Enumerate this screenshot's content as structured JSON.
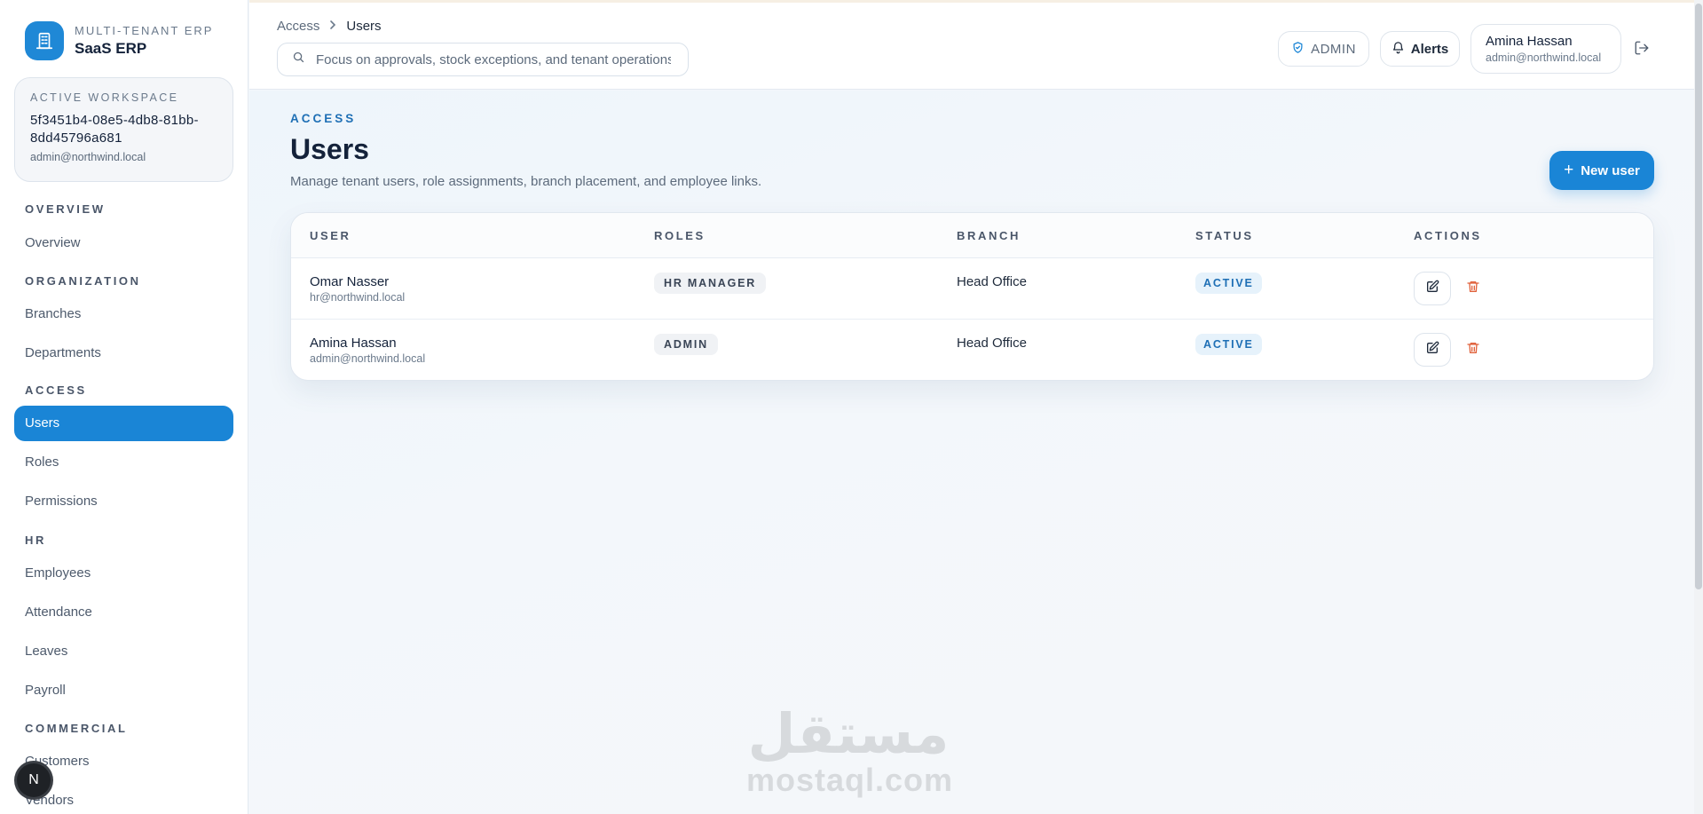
{
  "brand": {
    "subtitle": "MULTI-TENANT ERP",
    "name": "SaaS ERP",
    "icon": "building-icon"
  },
  "workspace": {
    "label": "ACTIVE WORKSPACE",
    "id": "5f3451b4-08e5-4db8-81bb-8dd45796a681",
    "email": "admin@northwind.local"
  },
  "nav": {
    "sections": [
      "OVERVIEW",
      "ORGANIZATION",
      "ACCESS",
      "HR",
      "COMMERCIAL"
    ],
    "items": [
      "Overview",
      "Branches",
      "Departments",
      "Users",
      "Roles",
      "Permissions",
      "Employees",
      "Attendance",
      "Leaves",
      "Payroll",
      "Customers",
      "Vendors"
    ],
    "active": "Users"
  },
  "devtools_badge": "N",
  "topbar": {
    "breadcrumb": [
      "Access",
      "Users"
    ],
    "search_placeholder": "Focus on approvals, stock exceptions, and tenant operations",
    "role_pill": "ADMIN",
    "alerts_label": "Alerts",
    "user": {
      "name": "Amina Hassan",
      "email": "admin@northwind.local"
    }
  },
  "page": {
    "eyebrow": "ACCESS",
    "title": "Users",
    "description": "Manage tenant users, role assignments, branch placement, and employee links.",
    "new_button": "New user"
  },
  "table": {
    "columns": [
      "USER",
      "ROLES",
      "BRANCH",
      "STATUS",
      "ACTIONS"
    ],
    "rows": [
      {
        "name": "Omar Nasser",
        "email": "hr@northwind.local",
        "role": "HR MANAGER",
        "branch": "Head Office",
        "status": "ACTIVE"
      },
      {
        "name": "Amina Hassan",
        "email": "admin@northwind.local",
        "role": "ADMIN",
        "branch": "Head Office",
        "status": "ACTIVE"
      }
    ]
  },
  "watermark": {
    "arabic": "مستقل",
    "latin": "mostaql.com"
  },
  "colors": {
    "accent": "#1a85d6",
    "danger": "#e0603a",
    "status_bg": "#e6f2fb"
  }
}
